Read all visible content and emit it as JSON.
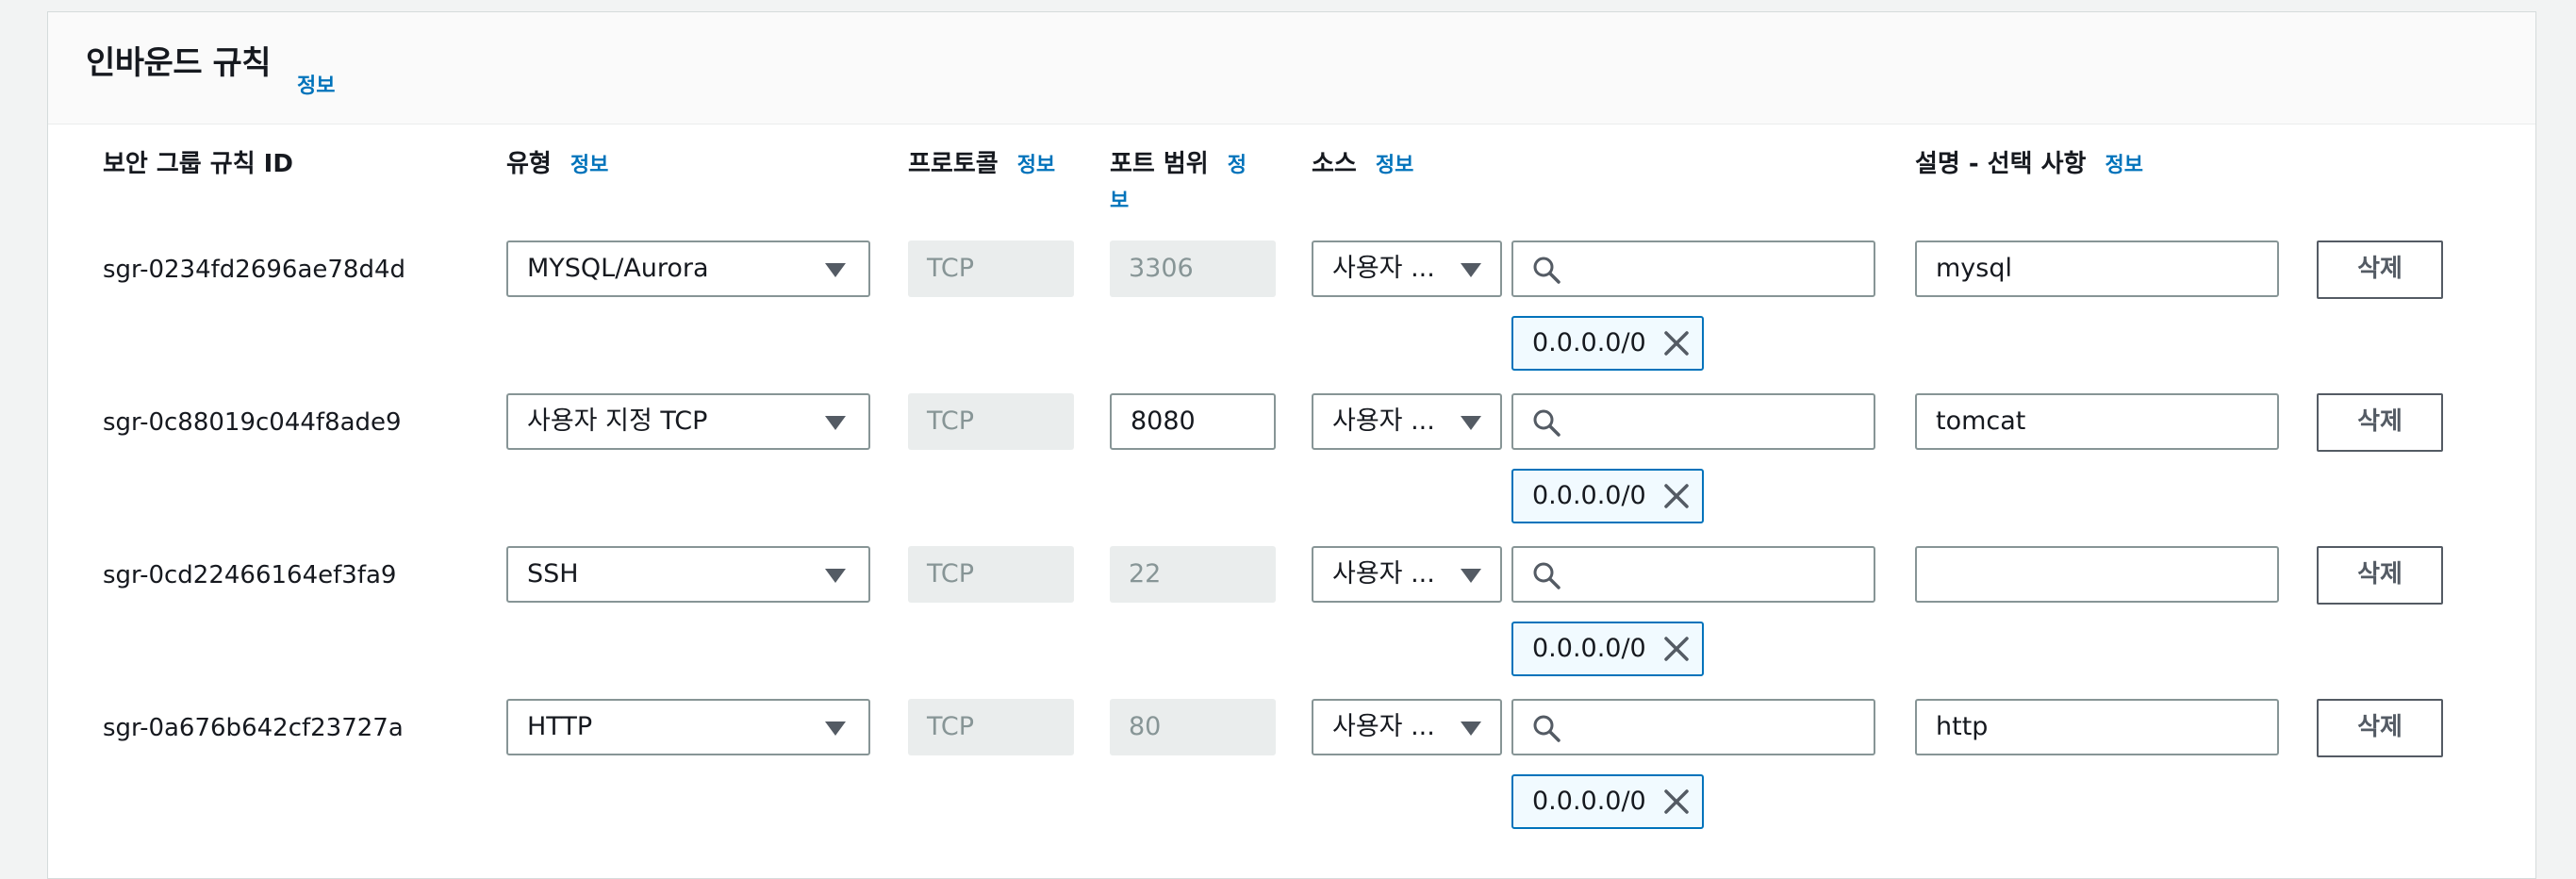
{
  "section": {
    "title": "인바운드 규칙",
    "info_label": "정보"
  },
  "columns": {
    "rule_id": "보안 그룹 규칙 ID",
    "type": "유형",
    "type_info": "정보",
    "protocol": "프로토콜",
    "protocol_info": "정보",
    "port_range": "포트 범위",
    "port_range_info_1": "정",
    "port_range_info_2": "보",
    "source": "소스",
    "source_info": "정보",
    "description": "설명 - 선택 사항",
    "description_info": "정보"
  },
  "rules": [
    {
      "id": "sgr-0234fd2696ae78d4d",
      "type": "MYSQL/Aurora",
      "protocol": "TCP",
      "port": "3306",
      "port_editable": false,
      "source_type": "사용자 ...",
      "search_value": "",
      "cidr": "0.0.0.0/0",
      "description": "mysql",
      "delete_label": "삭제"
    },
    {
      "id": "sgr-0c88019c044f8ade9",
      "type": "사용자 지정 TCP",
      "protocol": "TCP",
      "port": "8080",
      "port_editable": true,
      "source_type": "사용자 ...",
      "search_value": "",
      "cidr": "0.0.0.0/0",
      "description": "tomcat",
      "delete_label": "삭제"
    },
    {
      "id": "sgr-0cd22466164ef3fa9",
      "type": "SSH",
      "protocol": "TCP",
      "port": "22",
      "port_editable": false,
      "source_type": "사용자 ...",
      "search_value": "",
      "cidr": "0.0.0.0/0",
      "description": "",
      "delete_label": "삭제"
    },
    {
      "id": "sgr-0a676b642cf23727a",
      "type": "HTTP",
      "protocol": "TCP",
      "port": "80",
      "port_editable": false,
      "source_type": "사용자 ...",
      "search_value": "",
      "cidr": "0.0.0.0/0",
      "description": "http",
      "delete_label": "삭제"
    }
  ],
  "colors": {
    "link": "#0073bb",
    "border": "#879596",
    "readonly_bg": "#eaeded",
    "token_bg": "#f1faff"
  },
  "icons": {
    "search": "search-icon",
    "remove": "close-icon",
    "dropdown": "caret-down-icon"
  }
}
